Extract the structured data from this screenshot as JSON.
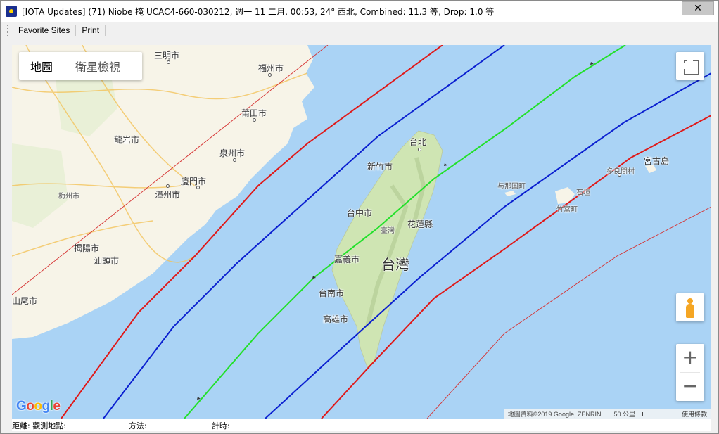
{
  "window": {
    "title": "[IOTA Updates] (71) Niobe 掩 UCAC4-660-030212, 週一 11 二月, 00:53, 24° 西北, Combined: 11.3 等, Drop:  1.0 等",
    "close_label": "✕"
  },
  "menu": {
    "favorite_sites": "Favorite Sites",
    "print": "Print"
  },
  "map": {
    "map_type_map": "地圖",
    "map_type_satellite": "衛星檢視",
    "zoom_in": "+",
    "zoom_out": "−",
    "google": "Google",
    "attribution": "地圖資料©2019 Google, ZENRIN",
    "scale": "50 公里",
    "terms": "使用條款",
    "colors": {
      "sea": "#aad3f5",
      "land": "#f7f4e8",
      "taiwan": "#cfe5b3",
      "center_line": "#22e02a",
      "limit_line": "#0a1fd0",
      "error_line": "#e01818",
      "outer_line": "#d63030"
    },
    "places": [
      "三明市",
      "福州市",
      "莆田市",
      "龍岩市",
      "泉州市",
      "廈門市",
      "梅州市",
      "漳州市",
      "揭陽市",
      "汕頭市",
      "山尾市",
      "台北",
      "新竹市",
      "台中市",
      "臺灣",
      "花蓮縣",
      "嘉義市",
      "台灣",
      "台南市",
      "高雄市",
      "与那国町",
      "多良間村",
      "宮古島",
      "石垣",
      "竹富町"
    ]
  },
  "status": {
    "distance": "距離: 觀測地點:",
    "method": "方法:",
    "timing": "計時:"
  }
}
